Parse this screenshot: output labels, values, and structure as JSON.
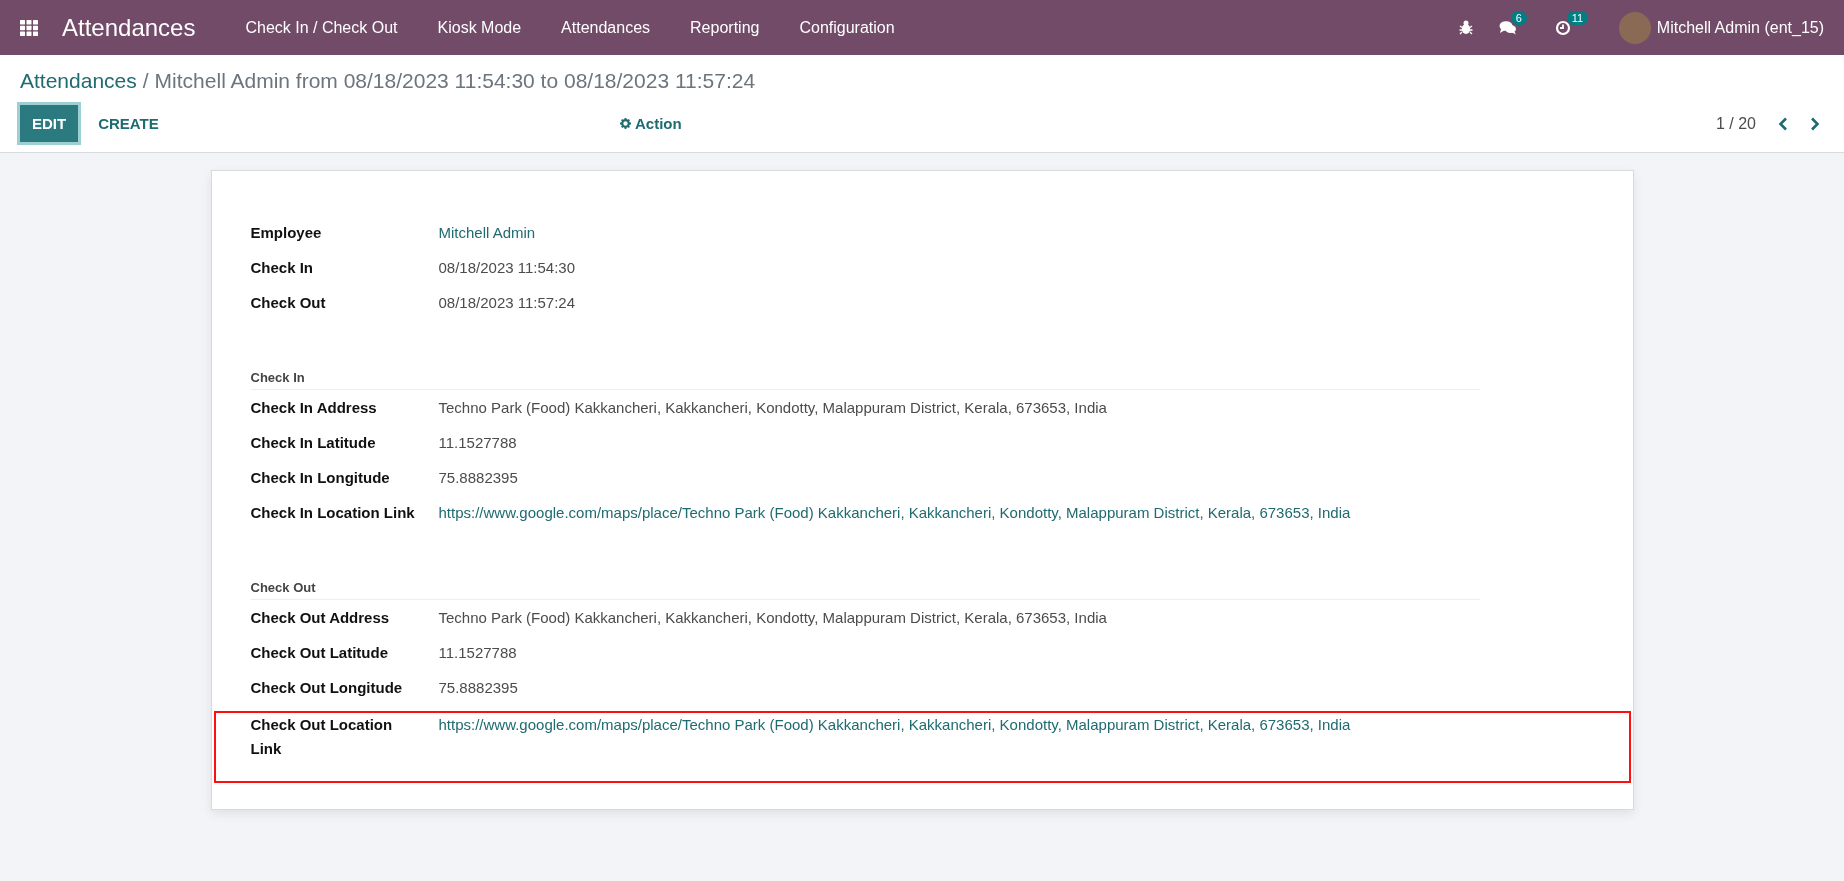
{
  "navbar": {
    "app_title": "Attendances",
    "menu": [
      "Check In / Check Out",
      "Kiosk Mode",
      "Attendances",
      "Reporting",
      "Configuration"
    ],
    "messages_count": "6",
    "activities_count": "11",
    "user": "Mitchell Admin (ent_15)"
  },
  "breadcrumb": {
    "parent": "Attendances",
    "separator": "/",
    "current": "Mitchell Admin from 08/18/2023 11:54:30 to 08/18/2023 11:57:24"
  },
  "control_panel": {
    "buttons": [
      {
        "label": "EDIT",
        "kind": "primary"
      },
      {
        "label": "CREATE",
        "kind": "secondary"
      }
    ],
    "action": "Action",
    "pager": "1 / 20"
  },
  "form": {
    "groups": [
      {
        "fields": [
          {
            "label": "Employee",
            "value": "Mitchell Admin",
            "kind": "link",
            "highlighted": false
          },
          {
            "label": "Check In",
            "value": "08/18/2023 11:54:30",
            "kind": "text",
            "highlighted": false
          },
          {
            "label": "Check Out",
            "value": "08/18/2023 11:57:24",
            "kind": "text",
            "highlighted": false
          }
        ]
      },
      {
        "title": "Check In",
        "fields": [
          {
            "label": "Check In Address",
            "value": "Techno Park (Food) Kakkancheri, Kakkancheri, Kondotty, Malappuram District, Kerala, 673653, India",
            "kind": "text",
            "highlighted": false
          },
          {
            "label": "Check In Latitude",
            "value": "11.1527788",
            "kind": "text",
            "highlighted": false
          },
          {
            "label": "Check In Longitude",
            "value": "75.8882395",
            "kind": "text",
            "highlighted": false
          },
          {
            "label": "Check In Location Link",
            "value": "https://www.google.com/maps/place/Techno Park (Food) Kakkancheri, Kakkancheri, Kondotty, Malappuram District, Kerala, 673653, India",
            "kind": "link",
            "highlighted": false
          }
        ]
      },
      {
        "title": "Check Out",
        "fields": [
          {
            "label": "Check Out Address",
            "value": "Techno Park (Food) Kakkancheri, Kakkancheri, Kondotty, Malappuram District, Kerala, 673653, India",
            "kind": "text",
            "highlighted": false
          },
          {
            "label": "Check Out Latitude",
            "value": "11.1527788",
            "kind": "text",
            "highlighted": false
          },
          {
            "label": "Check Out Longitude",
            "value": "75.8882395",
            "kind": "text",
            "highlighted": false
          },
          {
            "label": "Check Out Location Link",
            "value": "https://www.google.com/maps/place/Techno Park (Food) Kakkancheri, Kakkancheri, Kondotty, Malappuram District, Kerala, 673653, India",
            "kind": "link",
            "highlighted": true
          }
        ]
      }
    ]
  }
}
